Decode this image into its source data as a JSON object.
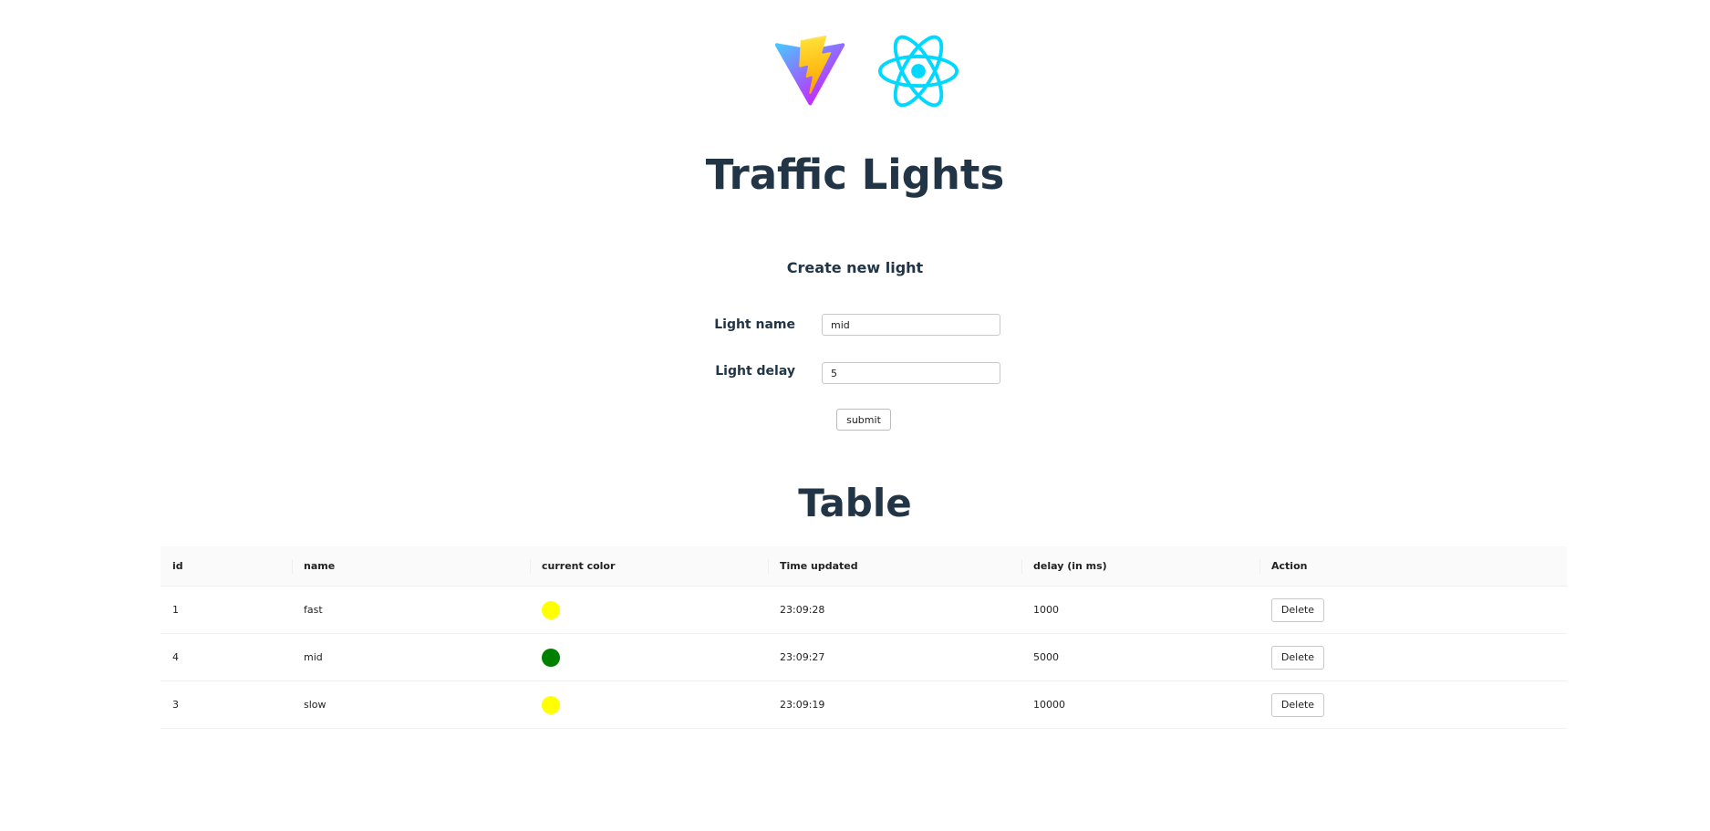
{
  "header": {
    "logos": [
      {
        "name": "vite-logo-icon",
        "colors": {
          "outer_start": "#41d1ff",
          "outer_end": "#bd34fe",
          "bolt_start": "#ffea83",
          "bolt_end": "#ffa800"
        }
      },
      {
        "name": "react-logo-icon",
        "color": "#00d8ff"
      }
    ],
    "title": "Traffic Lights"
  },
  "form": {
    "heading": "Create new light",
    "name_label": "Light name",
    "name_value": "mid",
    "delay_label": "Light delay",
    "delay_value": "5",
    "submit_label": "submit"
  },
  "table": {
    "title": "Table",
    "columns": [
      "id",
      "name",
      "current color",
      "Time updated",
      "delay (in ms)",
      "Action"
    ],
    "rows": [
      {
        "id": "1",
        "name": "fast",
        "color": "#ffff00",
        "time": "23:09:28",
        "delay": "1000",
        "action": "Delete"
      },
      {
        "id": "4",
        "name": "mid",
        "color": "#008000",
        "time": "23:09:27",
        "delay": "5000",
        "action": "Delete"
      },
      {
        "id": "3",
        "name": "slow",
        "color": "#ffff00",
        "time": "23:09:19",
        "delay": "10000",
        "action": "Delete"
      }
    ]
  },
  "theme": {
    "text_color": "#213547",
    "header_bg": "#fafafa",
    "border_color": "#f0f0f0"
  }
}
